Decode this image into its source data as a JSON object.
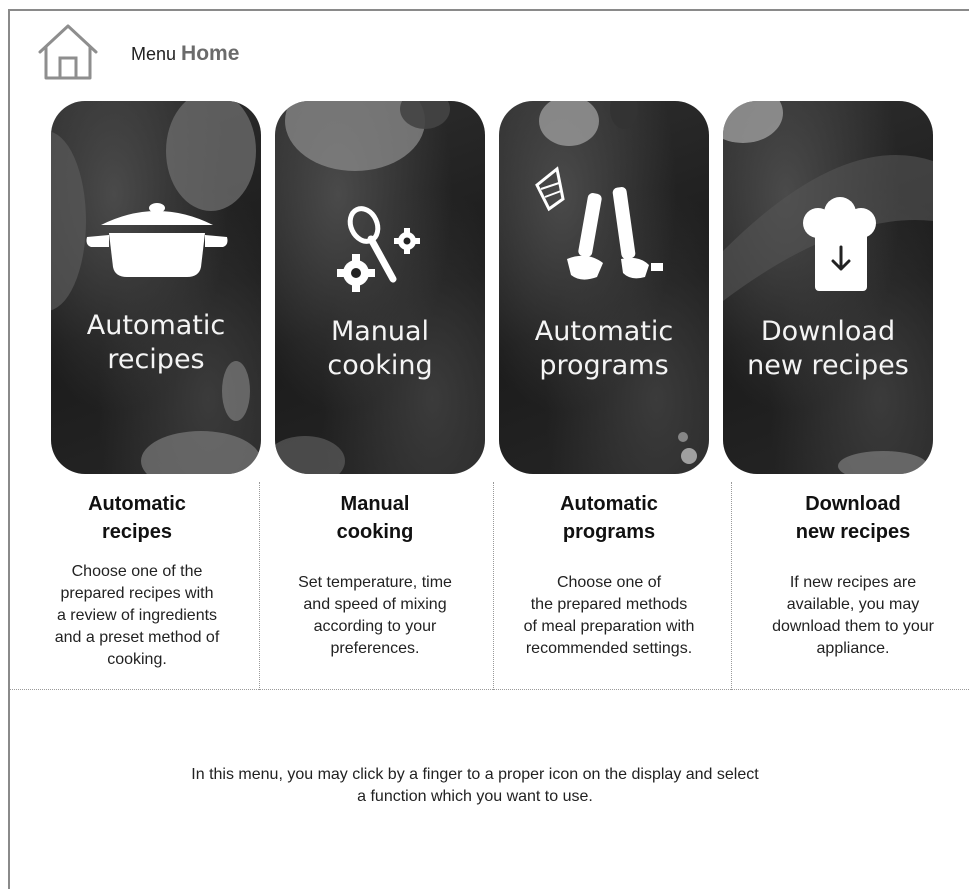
{
  "header": {
    "menu_label": "Menu",
    "title": "Home"
  },
  "cards": [
    {
      "id": "automatic-recipes",
      "tile_label": "Automatic\nrecipes",
      "title": "Automatic\nrecipes",
      "description": "Choose one of the\nprepared recipes with\na review of ingredients\nand a preset method of\ncooking.",
      "icon": "pot-icon"
    },
    {
      "id": "manual-cooking",
      "tile_label": "Manual\ncooking",
      "title": "Manual\ncooking",
      "description": "Set temperature, time\nand speed of mixing\naccording to your\npreferences.",
      "icon": "spoon-gears-icon"
    },
    {
      "id": "automatic-programs",
      "tile_label": "Automatic\nprograms",
      "title": "Automatic\nprograms",
      "description": "Choose one of\nthe prepared methods\nof meal preparation with\nrecommended settings.",
      "icon": "blender-attachments-icon"
    },
    {
      "id": "download-new-recipes",
      "tile_label": "Download\nnew recipes",
      "title": "Download\nnew recipes",
      "description": "If new recipes are\navailable, you may\ndownload them to your\nappliance.",
      "icon": "chef-hat-download-icon"
    }
  ],
  "footer": {
    "note": "In this menu, you may click by a finger to a proper icon on the display and select\na function which you want to use."
  }
}
